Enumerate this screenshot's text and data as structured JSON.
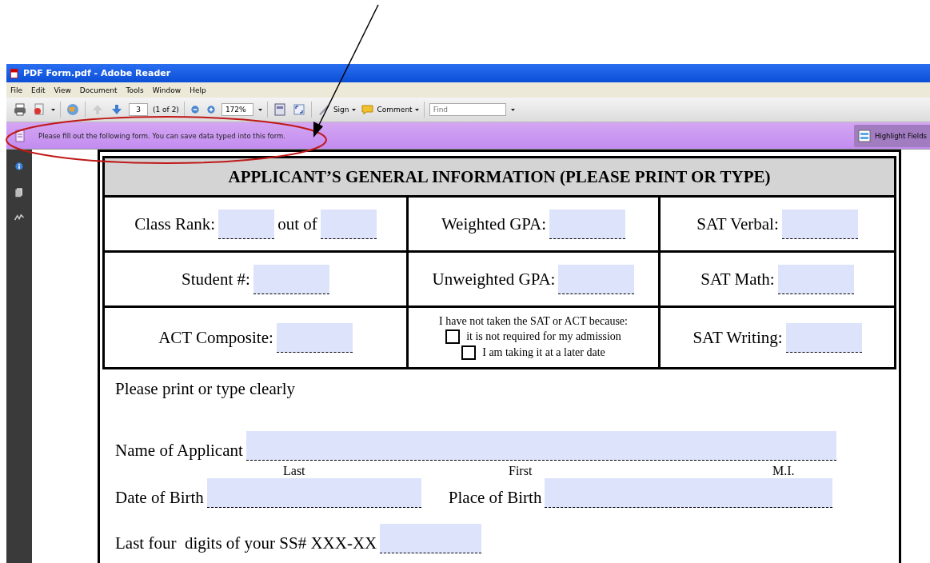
{
  "window": {
    "title": "PDF Form.pdf - Adobe Reader"
  },
  "menu": [
    "File",
    "Edit",
    "View",
    "Document",
    "Tools",
    "Window",
    "Help"
  ],
  "toolbar": {
    "page_number": "3",
    "page_count": "(1 of 2)",
    "zoom": "172%",
    "sign": "Sign",
    "comment": "Comment",
    "find_placeholder": "Find"
  },
  "message_bar": {
    "text": "Please fill out the following form. You can save data typed into this form.",
    "button": "Highlight Fields"
  },
  "form": {
    "header": "APPLICANT’S GENERAL INFORMATION (PLEASE PRINT OR TYPE)",
    "rows": [
      [
        {
          "parts": [
            {
              "kind": "label",
              "text": "Class Rank:"
            },
            {
              "kind": "field"
            },
            {
              "kind": "label",
              "text": "out of"
            },
            {
              "kind": "field"
            }
          ]
        },
        {
          "parts": [
            {
              "kind": "label",
              "text": "Weighted GPA:"
            },
            {
              "kind": "field"
            }
          ]
        },
        {
          "parts": [
            {
              "kind": "label",
              "text": "SAT Verbal:"
            },
            {
              "kind": "field"
            }
          ]
        }
      ],
      [
        {
          "parts": [
            {
              "kind": "label",
              "text": "Student #:"
            },
            {
              "kind": "field"
            }
          ]
        },
        {
          "parts": [
            {
              "kind": "label",
              "text": "Unweighted GPA:"
            },
            {
              "kind": "field"
            }
          ]
        },
        {
          "parts": [
            {
              "kind": "label",
              "text": "SAT Math:"
            },
            {
              "kind": "field"
            }
          ]
        }
      ],
      [
        {
          "parts": [
            {
              "kind": "label",
              "text": "ACT Composite:"
            },
            {
              "kind": "field"
            }
          ]
        },
        {
          "parts": [
            {
              "kind": "note",
              "text": "I have not taken the SAT or ACT because:"
            },
            {
              "kind": "checkbox",
              "text": "it is not required for my admission",
              "checked": false
            },
            {
              "kind": "checkbox",
              "text": "I am taking it at a later date",
              "checked": false
            }
          ]
        },
        {
          "parts": [
            {
              "kind": "label",
              "text": "SAT Writing:"
            },
            {
              "kind": "field"
            }
          ]
        }
      ]
    ],
    "instructions": "Please print or type clearly",
    "name_label": "Name of Applicant",
    "name_sublabels": [
      "Last",
      "First",
      "M.I."
    ],
    "birth_date_label": "Date of Birth",
    "birth_place_label": "Place of Birth",
    "ssn_label": "Last four  digits of your SS# XXX-XX"
  }
}
